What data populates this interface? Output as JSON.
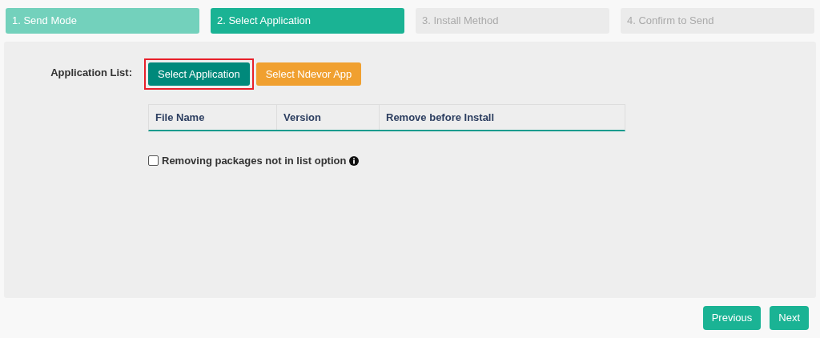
{
  "steps": [
    {
      "label": "1. Send Mode",
      "completed": true,
      "selected": false
    },
    {
      "label": "2. Select Application",
      "completed": false,
      "selected": true
    },
    {
      "label": "3. Install Method",
      "completed": false,
      "selected": false
    },
    {
      "label": "4. Confirm to Send",
      "completed": false,
      "selected": false
    }
  ],
  "application_list": {
    "label": "Application List:",
    "buttons": [
      {
        "label": "Select Application",
        "kind": "primary",
        "highlighted": true
      },
      {
        "label": "Select Ndevor App",
        "kind": "warning",
        "highlighted": false
      }
    ],
    "table": {
      "columns": [
        "File Name",
        "Version",
        "Remove before Install"
      ]
    }
  },
  "remove_option": {
    "label": "Removing packages not in list option",
    "checked": false
  },
  "footer_buttons": [
    "Previous",
    "Next"
  ]
}
